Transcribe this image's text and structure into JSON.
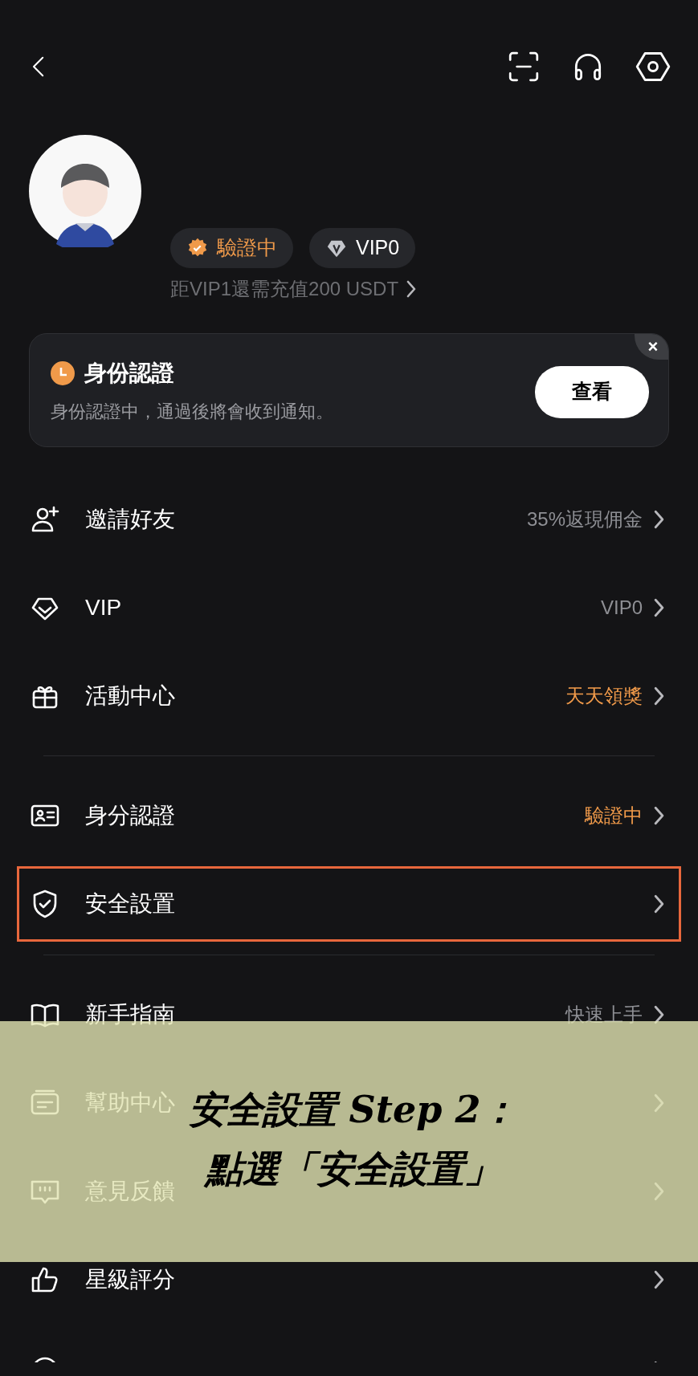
{
  "profile": {
    "badges": [
      {
        "label": "驗證中",
        "kind": "status"
      },
      {
        "label": "VIP0",
        "kind": "vip"
      }
    ],
    "vip_hint": "距VIP1還需充值200 USDT"
  },
  "notice": {
    "title": "身份認證",
    "message": "身份認證中，通過後將會收到通知。",
    "button": "查看",
    "close": "×"
  },
  "menu_groups": [
    [
      {
        "label": "邀請好友",
        "value": "35%返現佣金",
        "accent": false,
        "highlighted": false
      },
      {
        "label": "VIP",
        "value": "VIP0",
        "accent": false,
        "highlighted": false
      },
      {
        "label": "活動中心",
        "value": "天天領獎",
        "accent": true,
        "highlighted": false
      }
    ],
    [
      {
        "label": "身分認證",
        "value": "驗證中",
        "accent": true,
        "highlighted": false
      },
      {
        "label": "安全設置",
        "highlighted": true
      }
    ],
    [
      {
        "label": "新手指南",
        "value": "快速上手",
        "accent": false,
        "highlighted": false
      },
      {
        "label": "幫助中心",
        "highlighted": false
      },
      {
        "label": "意見反饋",
        "highlighted": false
      },
      {
        "label": "星級評分",
        "highlighted": false
      },
      {
        "highlighted": false
      }
    ]
  ],
  "caption": {
    "lines": [
      "安全設置 Step 2：",
      "點選「安全設置」"
    ]
  }
}
